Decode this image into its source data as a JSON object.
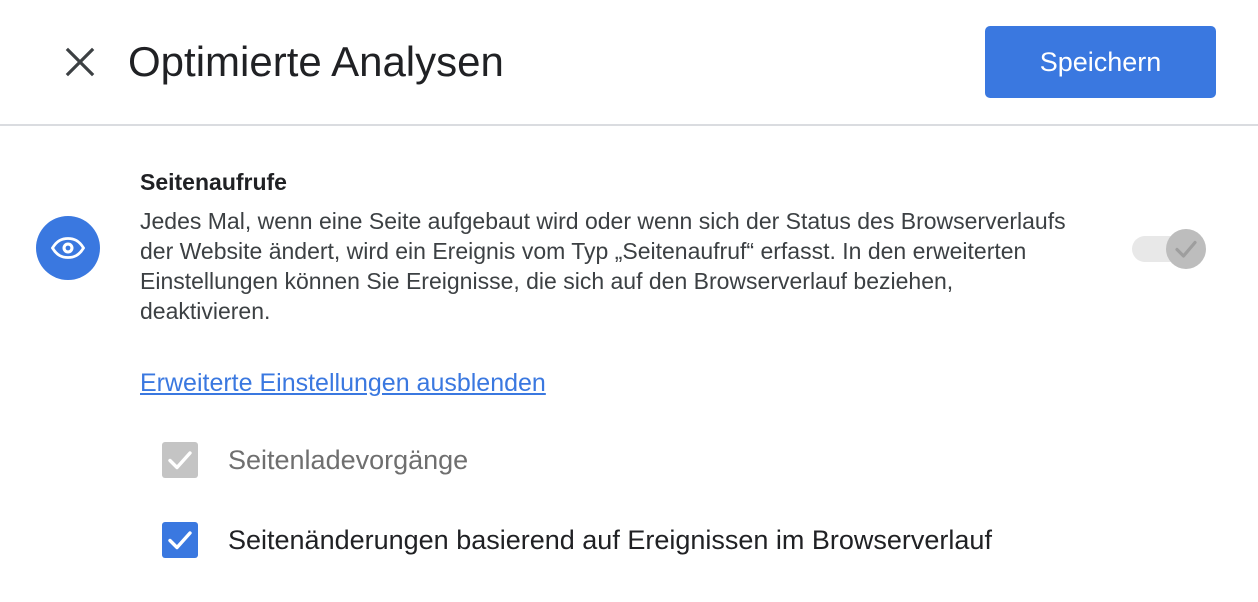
{
  "header": {
    "close_icon": "close-icon",
    "title": "Optimierte Analysen",
    "save_label": "Speichern"
  },
  "colors": {
    "accent": "#3a78e0",
    "disabled": "#c4c4c4",
    "divider": "#dadce0"
  },
  "section": {
    "icon": "eye-icon",
    "title": "Seitenaufrufe",
    "description": "Jedes Mal, wenn eine Seite aufgebaut wird oder wenn sich der Status des Browserverlaufs der Website ändert, wird ein Ereignis vom Typ „Seitenaufruf“ erfasst. In den erweiterten Einstellungen können Sie Ereignisse, die sich auf den Browserverlauf beziehen, deaktivieren.",
    "toggle_state": "on-disabled"
  },
  "advanced_link": "Erweiterte Einstellungen ausblenden",
  "options": [
    {
      "label": "Seitenladevorgänge",
      "checked": true,
      "disabled": true
    },
    {
      "label": "Seitenänderungen basierend auf Ereignissen im Browserverlauf",
      "checked": true,
      "disabled": false
    }
  ]
}
